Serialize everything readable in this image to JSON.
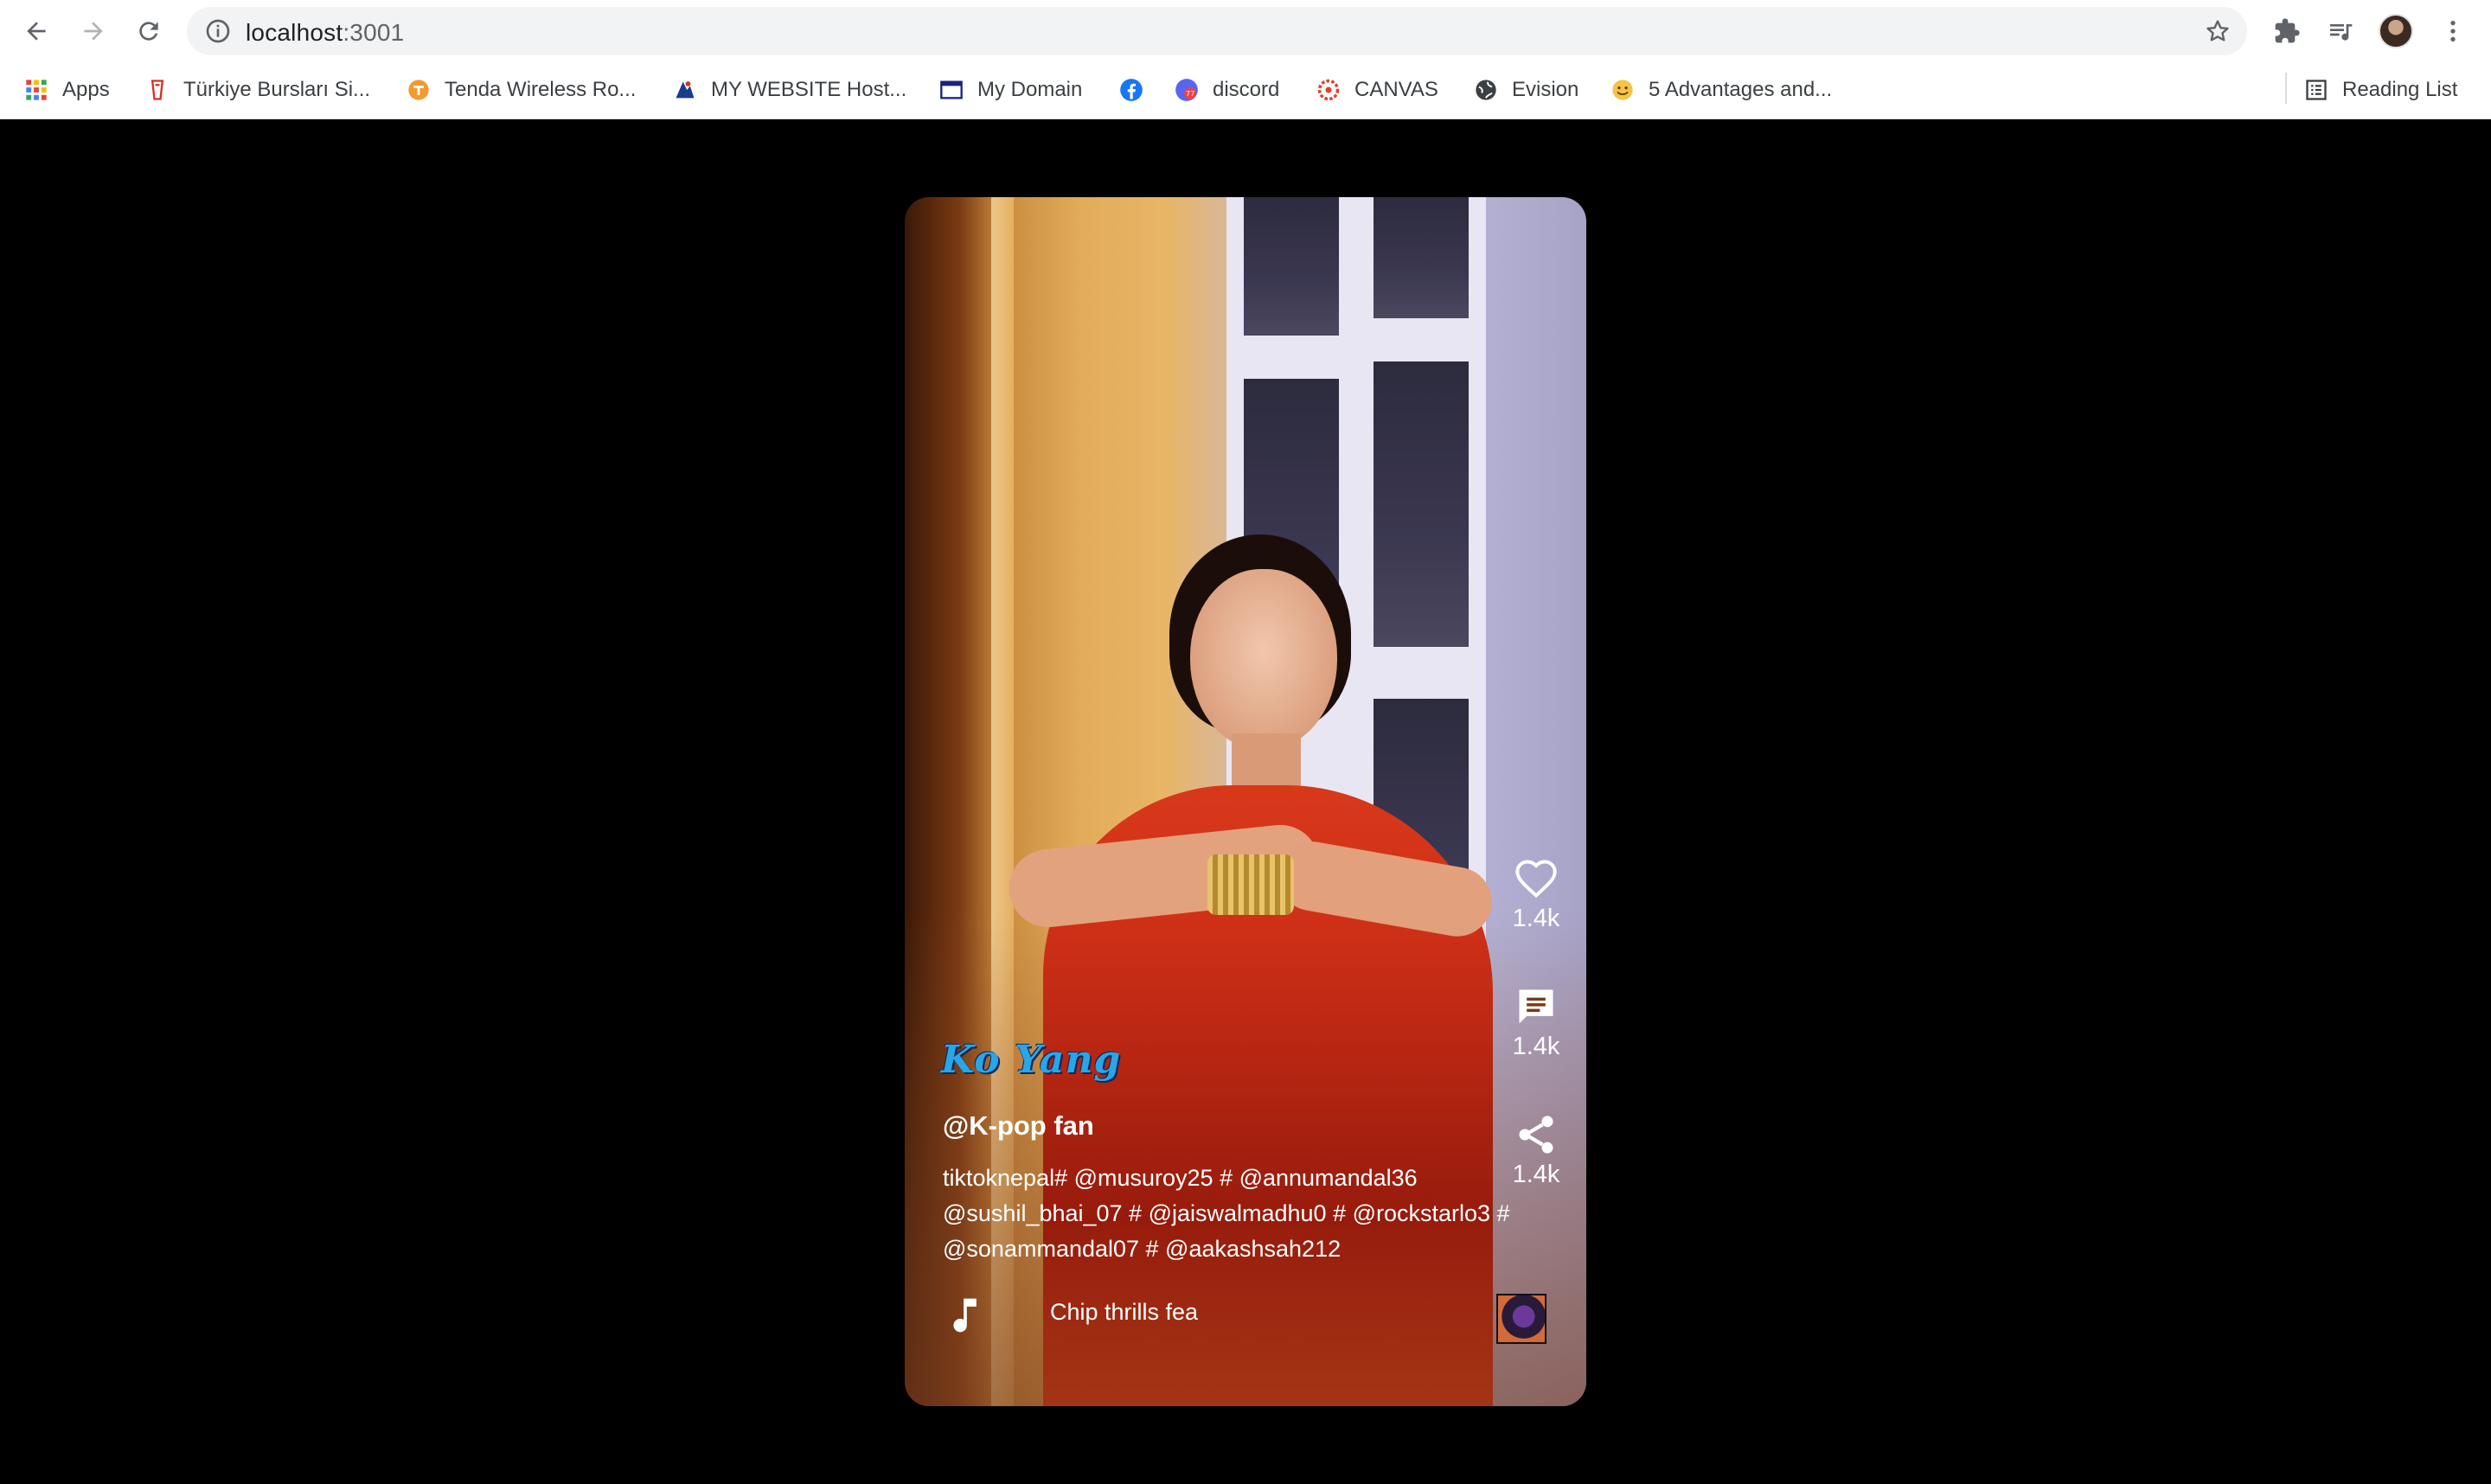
{
  "browser": {
    "url_host": "localhost",
    "url_port": ":3001",
    "reading_list_label": "Reading List",
    "bookmarks": [
      {
        "label": "Apps",
        "icon": "apps-grid-icon"
      },
      {
        "label": "Türkiye Bursları Si...",
        "icon": "turkiye-burslari-icon"
      },
      {
        "label": "Tenda Wireless Ro...",
        "icon": "tenda-icon"
      },
      {
        "label": "MY WEBSITE Host...",
        "icon": "hosting-icon"
      },
      {
        "label": "My Domain",
        "icon": "domain-icon"
      },
      {
        "label": "",
        "icon": "facebook-icon"
      },
      {
        "label": "discord",
        "icon": "discord-icon"
      },
      {
        "label": "CANVAS",
        "icon": "canvas-icon"
      },
      {
        "label": "Evision",
        "icon": "globe-icon"
      },
      {
        "label": "5 Advantages and...",
        "icon": "emoji-icon"
      }
    ]
  },
  "video": {
    "watermark": "Ko Yang",
    "username": "@K-pop fan",
    "caption": "tiktoknepal# @musuroy25 # @annumandal36 @sushil_bhai_07 # @jaiswalmadhu0 # @rockstarlo3 # @sonammandal07 # @aakashsah212",
    "song": "Chip thrills fea",
    "actions": {
      "likes": "1.4k",
      "comments": "1.4k",
      "shares": "1.4k"
    }
  },
  "colors": {
    "page_bg": "#000000",
    "chrome_bg": "#ffffff",
    "omnibox_bg": "#f1f3f4",
    "watermark": "#2aa6e8"
  }
}
